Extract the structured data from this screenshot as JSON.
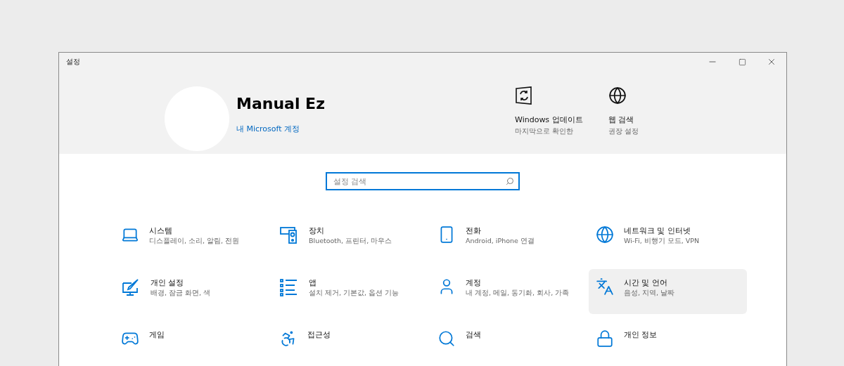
{
  "window": {
    "title": "설정"
  },
  "profile": {
    "name": "Manual Ez",
    "link": "내 Microsoft 계정"
  },
  "quick_links": [
    {
      "title": "Windows 업데이트",
      "subtitle": "마지막으로 확인한"
    },
    {
      "title": "웹 검색",
      "subtitle": "권장 설정"
    }
  ],
  "search": {
    "placeholder": "설정 검색"
  },
  "categories": [
    {
      "title": "시스템",
      "subtitle": "디스플레이, 소리, 알림, 전원",
      "selected": false
    },
    {
      "title": "장치",
      "subtitle": "Bluetooth, 프린터, 마우스",
      "selected": false
    },
    {
      "title": "전화",
      "subtitle": "Android, iPhone 연결",
      "selected": false
    },
    {
      "title": "네트워크 및 인터넷",
      "subtitle": "Wi-Fi, 비행기 모드, VPN",
      "selected": false
    },
    {
      "title": "개인 설정",
      "subtitle": "배경, 잠금 화면, 색",
      "selected": false
    },
    {
      "title": "앱",
      "subtitle": "설치 제거, 기본값, 옵션 기능",
      "selected": false
    },
    {
      "title": "계정",
      "subtitle": "내 계정, 메일, 동기화, 회사, 가족",
      "selected": false
    },
    {
      "title": "시간 및 언어",
      "subtitle": "음성, 지역, 날짜",
      "selected": true
    },
    {
      "title": "게임",
      "selected": false
    },
    {
      "title": "접근성",
      "selected": false
    },
    {
      "title": "검색",
      "selected": false
    },
    {
      "title": "개인 정보",
      "selected": false
    }
  ]
}
